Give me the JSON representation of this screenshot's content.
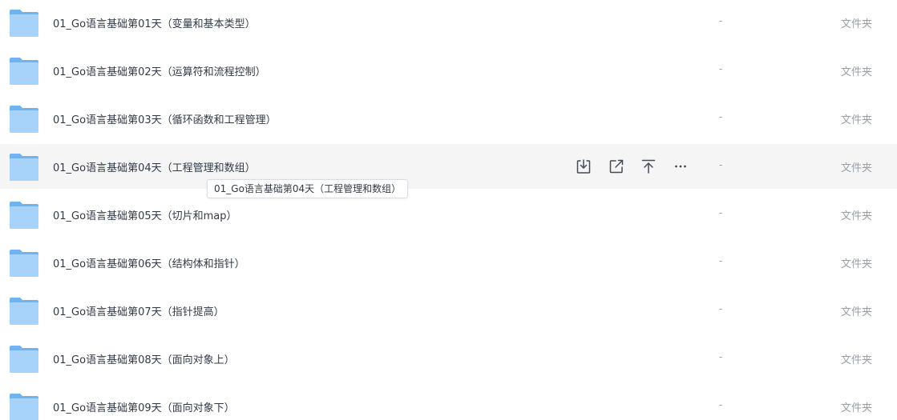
{
  "files": [
    {
      "name": "01_Go语言基础第01天（变量和基本类型）",
      "size": "-",
      "type": "文件夹"
    },
    {
      "name": "01_Go语言基础第02天（运算符和流程控制）",
      "size": "-",
      "type": "文件夹"
    },
    {
      "name": "01_Go语言基础第03天（循环函数和工程管理）",
      "size": "-",
      "type": "文件夹"
    },
    {
      "name": "01_Go语言基础第04天（工程管理和数组）",
      "size": "-",
      "type": "文件夹"
    },
    {
      "name": "01_Go语言基础第05天（切片和map）",
      "size": "-",
      "type": "文件夹"
    },
    {
      "name": "01_Go语言基础第06天（结构体和指针）",
      "size": "-",
      "type": "文件夹"
    },
    {
      "name": "01_Go语言基础第07天（指针提高）",
      "size": "-",
      "type": "文件夹"
    },
    {
      "name": "01_Go语言基础第08天（面向对象上）",
      "size": "-",
      "type": "文件夹"
    },
    {
      "name": "01_Go语言基础第09天（面向对象下）",
      "size": "-",
      "type": "文件夹"
    }
  ],
  "hovered_row": 3,
  "row_actions": [
    "download-icon",
    "share-icon",
    "move-to-top-icon",
    "more-icon"
  ],
  "tooltip": "01_Go语言基础第04天（工程管理和数组）",
  "colors": {
    "folder_light": "#a7d3fb",
    "folder_dark": "#6fb3f2",
    "hover_bg": "#f5f5f6",
    "text": "#333a45",
    "muted": "#9aa0a8"
  }
}
